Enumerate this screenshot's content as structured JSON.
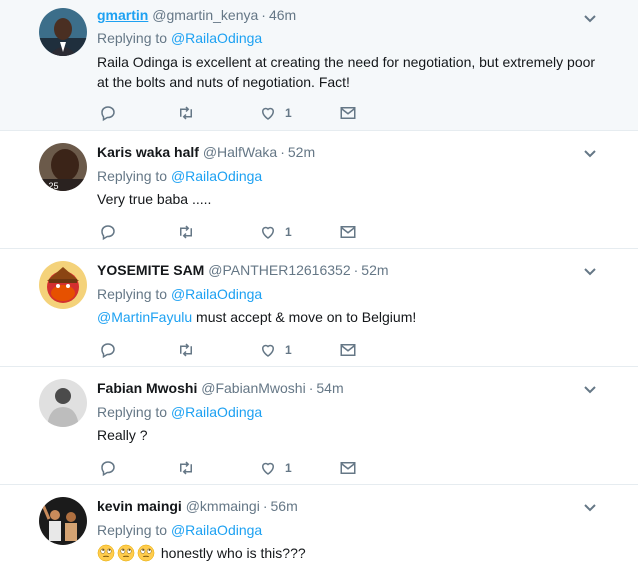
{
  "tweets": [
    {
      "name": "gmartin",
      "handle": "@gmartin_kenya",
      "dot": "·",
      "time": "46m",
      "replying_prefix": "Replying to",
      "replying_to": "@RailaOdinga",
      "text_line1": "Raila Odinga is excellent at creating the need for negotiation, but extremely poor",
      "text_line2": "at the bolts and nuts of negotiation. Fact!",
      "like_count": "1"
    },
    {
      "name": "Karis waka half",
      "handle": "@HalfWaka",
      "dot": "·",
      "time": "52m",
      "replying_prefix": "Replying to",
      "replying_to": "@RailaOdinga",
      "text": "Very true baba .....",
      "avatar_overlay": "3.25",
      "like_count": "1"
    },
    {
      "name": "YOSEMITE SAM",
      "handle": "@PANTHER12616352",
      "dot": "·",
      "time": "52m",
      "replying_prefix": "Replying to",
      "replying_to": "@RailaOdinga",
      "text_mention": "@MartinFayulu",
      "text_rest": " must accept & move on to Belgium!",
      "like_count": "1"
    },
    {
      "name": "Fabian Mwoshi",
      "handle": "@FabianMwoshi",
      "dot": "·",
      "time": "54m",
      "replying_prefix": "Replying to",
      "replying_to": "@RailaOdinga",
      "text": "Really ?",
      "like_count": "1"
    },
    {
      "name": "kevin maingi",
      "handle": "@kmmaingi",
      "dot": "·",
      "time": "56m",
      "replying_prefix": "Replying to",
      "replying_to": "@RailaOdinga",
      "text": "honestly who is this???",
      "emojis": [
        "rolling-eyes-emoji",
        "rolling-eyes-emoji",
        "rolling-eyes-emoji"
      ]
    }
  ],
  "icons": {
    "reply": "reply-icon",
    "retweet": "retweet-icon",
    "like": "like-icon",
    "dm": "direct-message-icon",
    "more": "chevron-down-icon"
  },
  "colors": {
    "link": "#1da1f2",
    "muted": "#657786",
    "highlight_bg": "#f5f8fa",
    "border": "#e6ecf0"
  }
}
